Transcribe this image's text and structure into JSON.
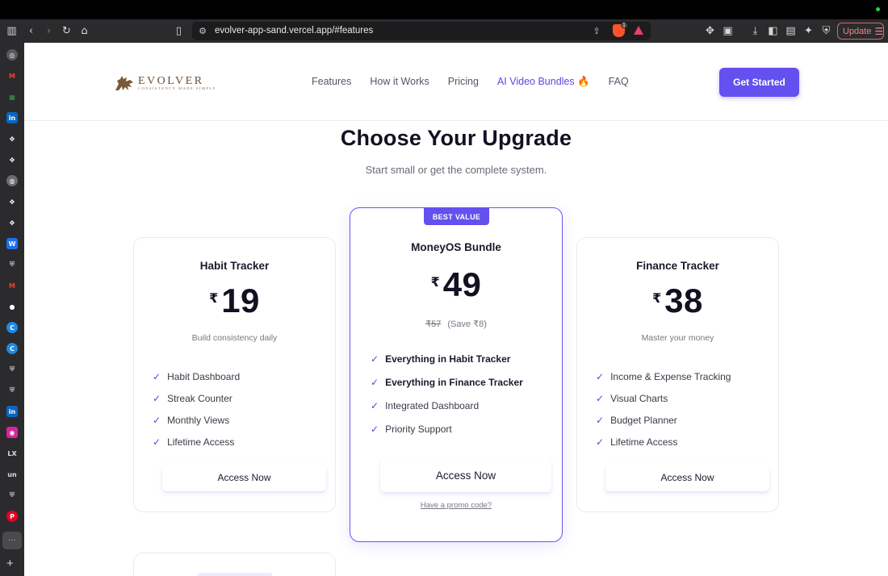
{
  "browser": {
    "url": "evolver-app-sand.vercel.app/#features",
    "brave_count": "1",
    "update_label": "Update"
  },
  "nav": {
    "logo_name": "EVOLVER",
    "logo_tagline": "CONSISTENCY MADE SIMPLE",
    "links": [
      "Features",
      "How it Works",
      "Pricing",
      "AI Video Bundles 🔥",
      "FAQ"
    ],
    "cta": "Get Started"
  },
  "hero": {
    "title": "Choose Your Upgrade",
    "subtitle": "Start small or get the complete system."
  },
  "cards": [
    {
      "title": "Habit Tracker",
      "currency": "₹",
      "price": "19",
      "description": "Build consistency daily",
      "features": [
        "Habit Dashboard",
        "Streak Counter",
        "Monthly Views",
        "Lifetime Access"
      ],
      "button": "Access Now"
    },
    {
      "badge": "BEST VALUE",
      "title": "MoneyOS Bundle",
      "currency": "₹",
      "price": "49",
      "old_price": "₹57",
      "savings": "(Save ₹8)",
      "features": [
        "Everything in Habit Tracker",
        "Everything in Finance Tracker",
        "Integrated Dashboard",
        "Priority Support"
      ],
      "button": "Access Now",
      "promo": "Have a promo code?"
    },
    {
      "title": "Finance Tracker",
      "currency": "₹",
      "price": "38",
      "description": "Master your money",
      "features": [
        "Income & Expense Tracking",
        "Visual Charts",
        "Budget Planner",
        "Lifetime Access"
      ],
      "button": "Access Now"
    }
  ],
  "colors": {
    "accent": "#6450ef",
    "logo": "#6b4d2e"
  }
}
